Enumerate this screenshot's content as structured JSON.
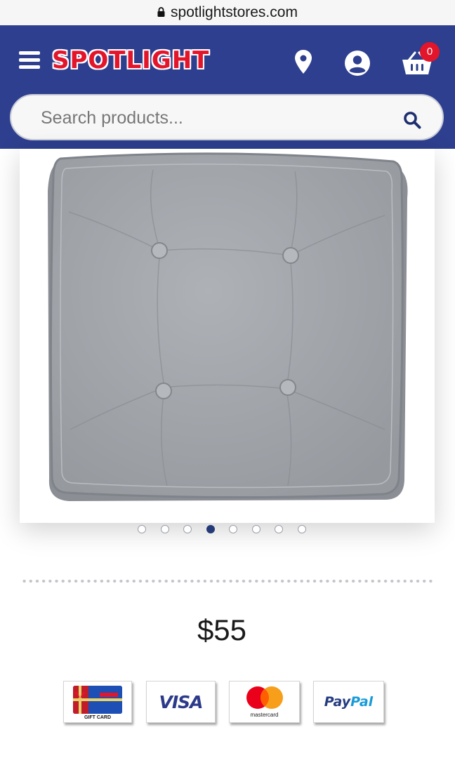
{
  "browser": {
    "url": "spotlightstores.com"
  },
  "header": {
    "logo_text": "SPOTLIGHT",
    "cart_count": "0",
    "brand_color": "#2d3f8e",
    "accent_color": "#e3152a",
    "icons": [
      "menu-icon",
      "location-pin-icon",
      "account-icon",
      "cart-icon"
    ]
  },
  "search": {
    "placeholder": "Search products...",
    "icon": "search-icon"
  },
  "product": {
    "image": "grey tufted square cushion",
    "carousel": {
      "total": 8,
      "active_index": 3
    },
    "price": "$55"
  },
  "payment_methods": {
    "gift_card_label": "GIFT CARD",
    "visa_label": "VISA",
    "mastercard_label": "mastercard",
    "paypal_part1": "Pay",
    "paypal_part2": "Pal"
  }
}
